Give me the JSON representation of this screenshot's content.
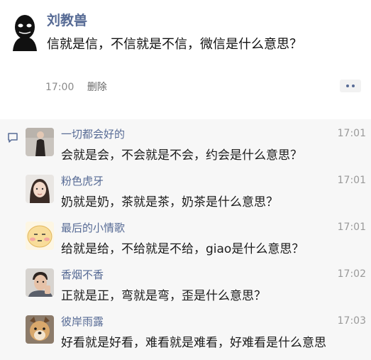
{
  "post": {
    "author": "刘教兽",
    "text": "信就是信，不信就是不信，微信是什么意思？",
    "time": "17:00",
    "delete_label": "删除"
  },
  "comments": [
    {
      "name": "一切都会好的",
      "time": "17:01",
      "text": "会就是会，不会就是不会，约会是什么意思？",
      "avatar": "woman-dark-dress-avatar"
    },
    {
      "name": "粉色虎牙",
      "time": "17:01",
      "text": "奶就是奶，茶就是茶，奶茶是什么意思？",
      "avatar": "girl-long-hair-avatar"
    },
    {
      "name": "最后的小情歌",
      "time": "17:01",
      "text": "给就是给，不给就是不给，giao是什么意思？",
      "avatar": "emoji-face-avatar"
    },
    {
      "name": "香烟不香",
      "time": "17:02",
      "text": "正就是正，弯就是弯，歪是什么意思？",
      "avatar": "man-avatar"
    },
    {
      "name": "彼岸雨露",
      "time": "17:03",
      "text": "好看就是好看，难看就是难看，好难看是什么意思",
      "avatar": "dog-avatar"
    }
  ],
  "colors": {
    "name": "#576b95",
    "comment_bg": "#f7f7f7",
    "time": "#9a9a9a"
  }
}
